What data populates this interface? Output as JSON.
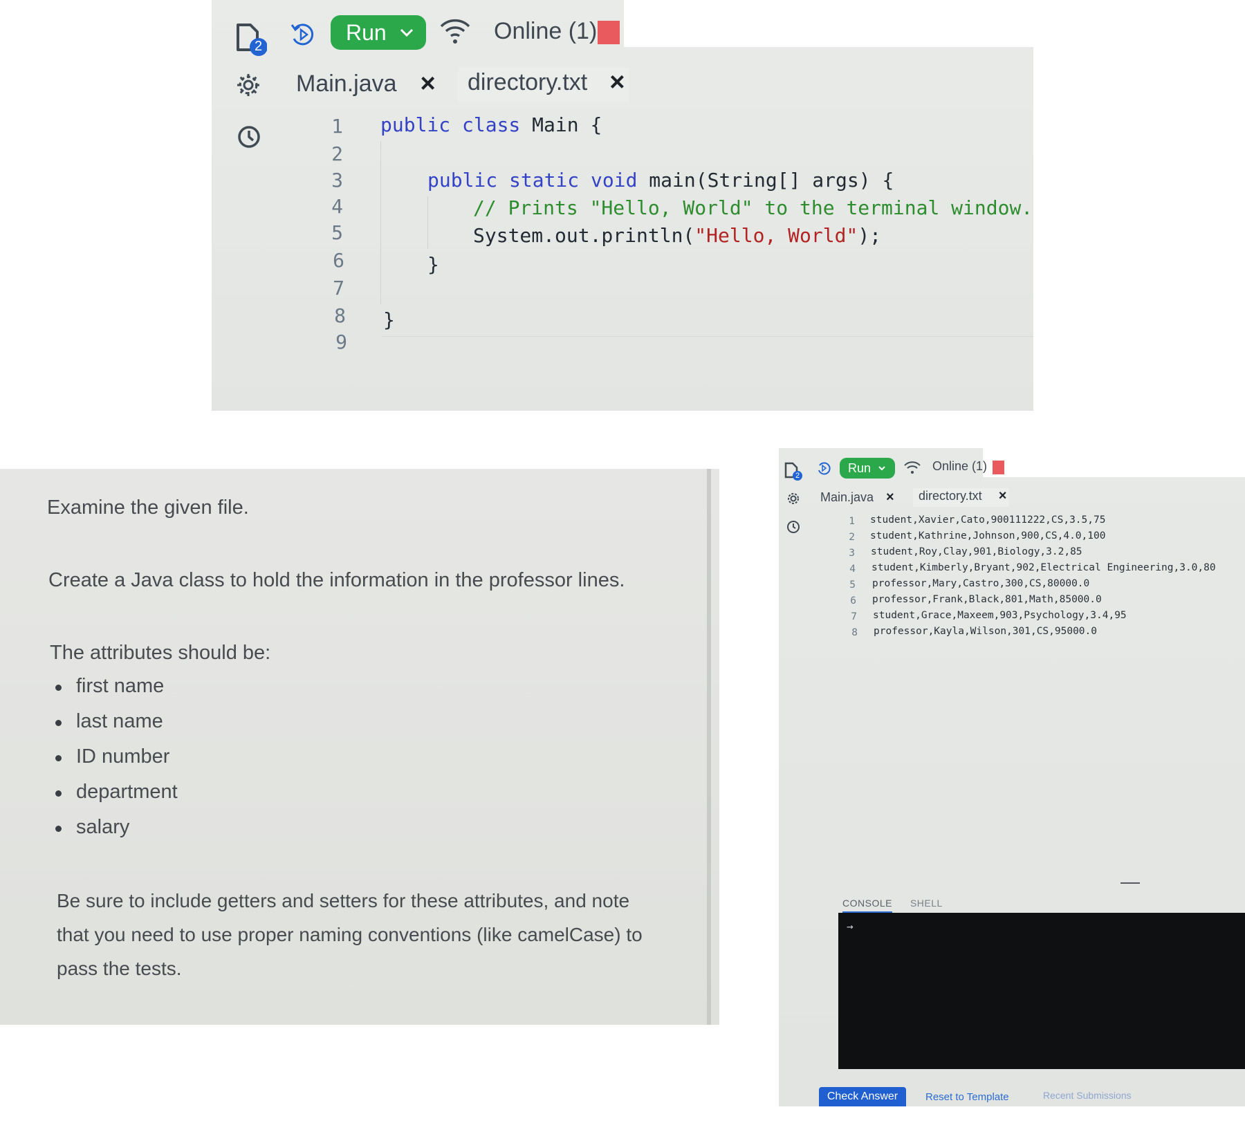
{
  "ide_top": {
    "run_label": "Run",
    "online_label": "Online (1)",
    "badge_count": "2",
    "tabs": [
      {
        "label": "Main.java",
        "close": "×"
      },
      {
        "label": "directory.txt",
        "close": "×"
      }
    ],
    "line_numbers": [
      "1",
      "2",
      "3",
      "4",
      "5",
      "6",
      "7",
      "8",
      "9"
    ],
    "code": {
      "l1_kw": "public class",
      "l1_rest": " Main {",
      "l3_kw": "public static void",
      "l3_rest": " main(String[] args) {",
      "l4_comment": "// Prints \"Hello, World\" to the terminal window.",
      "l5_pre": "System.out.println(",
      "l5_str": "\"Hello, World\"",
      "l5_post": ");",
      "l6": "}",
      "l8": "}"
    }
  },
  "instructions": {
    "p1": "Examine the given file.",
    "p2": "Create a Java class to hold the information in the professor lines.",
    "p3": "The attributes should be:",
    "attributes": [
      "first name",
      "last name",
      "ID number",
      "department",
      "salary"
    ],
    "p4": "Be sure to include getters and setters for these attributes, and note that you need to use proper naming conventions (like camelCase) to pass the tests."
  },
  "ide_bottom": {
    "run_label": "Run",
    "online_label": "Online (1)",
    "badge_count": "2",
    "tabs": [
      {
        "label": "Main.java",
        "close": "×"
      },
      {
        "label": "directory.txt",
        "close": "×"
      }
    ],
    "line_numbers": [
      "1",
      "2",
      "3",
      "4",
      "5",
      "6",
      "7",
      "8"
    ],
    "lines": [
      "student,Xavier,Cato,900111222,CS,3.5,75",
      "student,Kathrine,Johnson,900,CS,4.0,100",
      "student,Roy,Clay,901,Biology,3.2,85",
      "student,Kimberly,Bryant,902,Electrical Engineering,3.0,80",
      "professor,Mary,Castro,300,CS,80000.0",
      "professor,Frank,Black,801,Math,85000.0",
      "student,Grace,Maxeem,903,Psychology,3.4,95",
      "professor,Kayla,Wilson,301,CS,95000.0"
    ],
    "console_tab": "CONSOLE",
    "shell_tab": "SHELL",
    "console_prompt": "→",
    "buttons": {
      "check": "Check Answer",
      "reset": "Reset to Template",
      "recent": "Recent Submissions"
    }
  },
  "colors": {
    "run_green": "#2aa84a",
    "stop_red": "#e85a5e",
    "keyword_blue": "#3442c6",
    "comment_green": "#2d8c2d",
    "string_red": "#b22323",
    "primary_blue": "#1f5fd0",
    "console_bg": "#0e1011"
  }
}
